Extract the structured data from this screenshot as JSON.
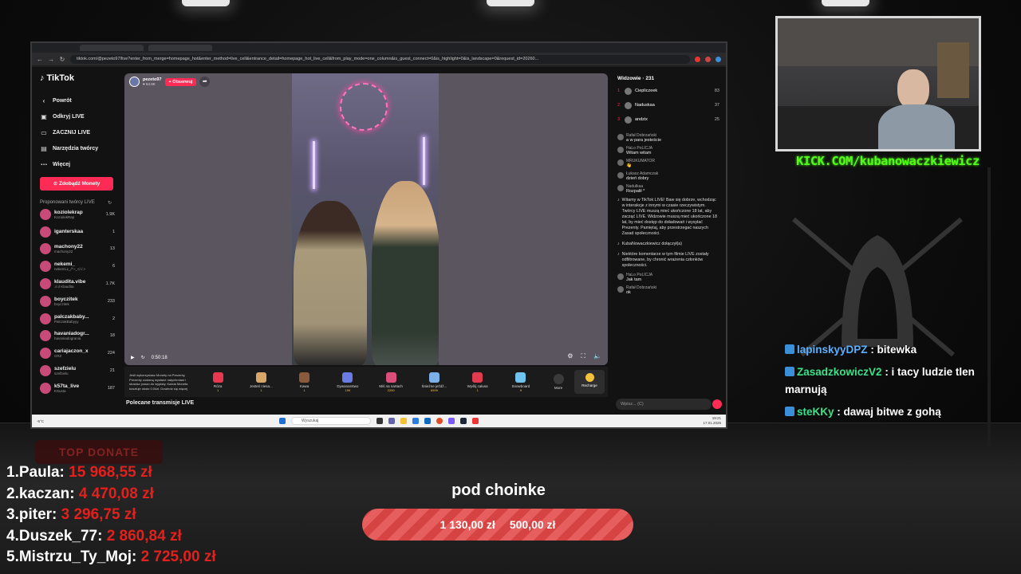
{
  "browser": {
    "url": "tiktok.com/@pezeto97/live?enter_from_merge=homepage_hot&enter_method=live_cell&entrance_detail=homepage_hot_live_cell&from_play_mode=one_column&is_guest_connect=0&is_highlight=0&is_landscape=0&request_id=20260..."
  },
  "tiktok": {
    "logo": "TikTok",
    "nav": [
      "Powrót",
      "Odkryj LIVE",
      "ZACZNIJ LIVE",
      "Narzędzia twórcy",
      "Więcej"
    ],
    "coins_button": "Zdobądź Monety",
    "suggested_title": "Proponowani twórcy LIVE",
    "creators": [
      {
        "name": "koziolekrap",
        "sub": "KoziolekRap",
        "count": "1.9K"
      },
      {
        "name": "iganterskaa",
        "sub": "",
        "count": "1"
      },
      {
        "name": "machony22",
        "sub": "machony22",
        "count": "13"
      },
      {
        "name": "nekemi_",
        "sub": "nekemi ̶c_/^~_</./.>",
        "count": "6"
      },
      {
        "name": "klaudita.vibe",
        "sub": ".ıl.ıl Klaudita",
        "count": "1.7K"
      },
      {
        "name": "boyczitek",
        "sub": "boyczitek",
        "count": "233"
      },
      {
        "name": "palczakbaby...",
        "sub": "PalczakBabyyy",
        "count": "2"
      },
      {
        "name": "havaniadogr...",
        "sub": "havaniadogrania",
        "count": "18"
      },
      {
        "name": "cariajaczon_x",
        "sub": "CRZ",
        "count": "224"
      },
      {
        "name": "szefzielu",
        "sub": "szefzielu",
        "count": "21"
      },
      {
        "name": "k57ta_live",
        "sub": "KSusta",
        "count": "187"
      }
    ],
    "host": {
      "name": "pezeto97",
      "likes": "64.9K",
      "follow_label": "+ Obserwuj"
    },
    "player": {
      "time": "0:50:18"
    },
    "gift_note": "Jeśli wykorzystasz Monety na Prezenty, Prezenty zostaną wysłane natychmiast i stracisz prawo do wypłaty. Każda Moneta kosztuje około 0.04zł. Dowiedz się więcej",
    "gifts": [
      {
        "name": "Róża",
        "price": "1",
        "color": "#e8384f"
      },
      {
        "name": "Jesteś niesa...",
        "price": "1",
        "color": "#d9a66a"
      },
      {
        "name": "Kawa",
        "price": "1",
        "color": "#8b5a3c"
      },
      {
        "name": "Dywanarstwo",
        "price": "199",
        "color": "#6a7be6"
      },
      {
        "name": "Miś na nartach",
        "price": "2200",
        "color": "#d94f7a"
      },
      {
        "name": "Śnieżne jeźdź...",
        "price": "6999",
        "color": "#7bb0e8"
      },
      {
        "name": "Wyślij całusa",
        "price": "1",
        "color": "#e23b4f"
      },
      {
        "name": "Snowboard",
        "price": "9",
        "color": "#6fc3ef"
      }
    ],
    "gift_more": "More",
    "recharge": "Recharge",
    "recommended": "Polecane transmisje LIVE",
    "viewers_title": "Widzowie · 231",
    "top_viewers": [
      {
        "rank": "1",
        "name": "Ciepliczeek",
        "score": "83"
      },
      {
        "rank": "2",
        "name": "Naduskaa",
        "score": "37"
      },
      {
        "rank": "3",
        "name": "andzix",
        "score": "25"
      }
    ],
    "chat": [
      {
        "user": "Rafał Dobrzański",
        "text": "a w para jesteście"
      },
      {
        "user": "HaLo PoLICJA",
        "text": "Witam witam"
      },
      {
        "user": "MRUKUMATOR",
        "text": "👋"
      },
      {
        "user": "Łukasz Adamczak",
        "text": "dzień dobry"
      },
      {
        "user": "Nadułkaa",
        "text": "Rozpalił *"
      }
    ],
    "system_welcome": "Witamy w TikTok LIVE! Baw się dobrze, wchodząc w interakcje z innymi w czasie rzeczywistym. Twórcy LIVE muszą mieć ukończone 18 lat, aby zacząć LIVE. Widzowie muszą mieć ukończone 18 lat, by mieć dostęp do doładowań i wysyłać Prezenty. Pamiętaj, aby przestrzegać naszych Zasad społeczności.",
    "joined": "KubaNowaczkiewicz  dołączył(a)",
    "filter_note": "Niektóre komentarze w tym filmie LIVE zostały odfiltrowane, by chronić wrażenia członków społeczności.",
    "chat2": [
      {
        "user": "HaLo PoLICJA",
        "text": "Jak tam"
      },
      {
        "user": "Rafał Dobrzański",
        "text": "ok"
      }
    ],
    "chat_placeholder": "Wpisz... (C)"
  },
  "taskbar": {
    "search_placeholder": "Wyszukaj",
    "weather": "-5°C",
    "time": "19:21",
    "date": "17.01.2026"
  },
  "stream_overlay": {
    "kick_url": "KICK.COM/kubanowaczkiewicz",
    "kick_chat": [
      {
        "user": "lapinskyyDPZ",
        "text": ": bitewka",
        "color": "blue"
      },
      {
        "user": "ZasadzkowiczV2",
        "text": ": i tacy ludzie tlen marnują",
        "color": "green"
      },
      {
        "user": "steKKy",
        "text": ": dawaj bitwe z gohą",
        "color": "green"
      }
    ],
    "top_donate_label": "TOP DONATE",
    "donors": [
      {
        "rank": "1.",
        "name": "Paula:",
        "amount": "15 968,55 zł"
      },
      {
        "rank": "2.",
        "name": "kaczan:",
        "amount": "4 470,08 zł"
      },
      {
        "rank": "3.",
        "name": "piter:",
        "amount": "3 296,75 zł"
      },
      {
        "rank": "4.",
        "name": "Duszek_77:",
        "amount": "2 860,84 zł"
      },
      {
        "rank": "5.",
        "name": "Mistrzu_Ty_Moj:",
        "amount": "2 725,00 zł"
      }
    ],
    "goal_title": "pod choinke",
    "goal_current": "1 130,00 zł",
    "goal_target": "500,00 zł",
    "goal_progress": 1.0,
    "accent_red": "#e4201c",
    "kick_green": "#53fc18"
  }
}
